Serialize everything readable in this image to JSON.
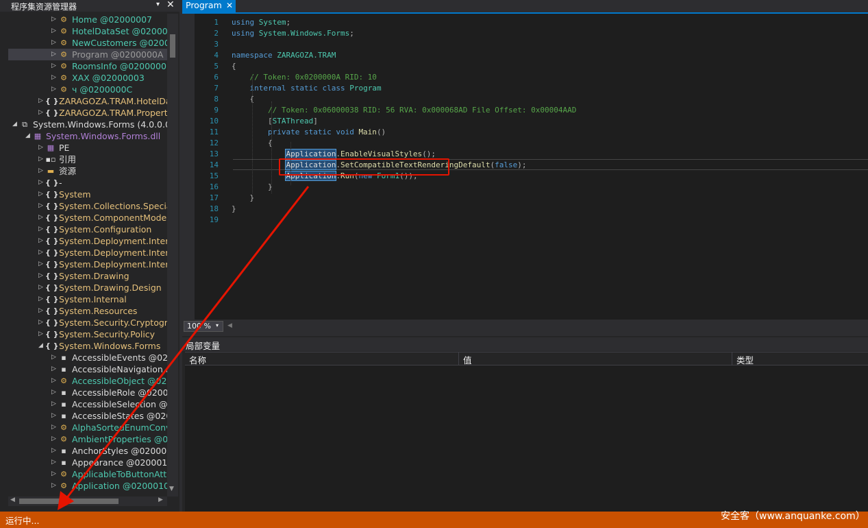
{
  "explorer": {
    "title": "程序集资源管理器",
    "dropdown_glyph": "▾",
    "close_glyph": "✕",
    "items": [
      {
        "label": "Home @02000007",
        "color": "green",
        "icon": "class-icon",
        "indent": 3,
        "expander": "▷"
      },
      {
        "label": "HotelDataSet @0200000",
        "color": "green",
        "icon": "class-icon",
        "indent": 3,
        "expander": "▷"
      },
      {
        "label": "NewCustomers @0200000",
        "color": "green",
        "icon": "class-icon",
        "indent": 3,
        "expander": "▷"
      },
      {
        "label": "Program @0200000A",
        "color": "gray",
        "icon": "class-icon",
        "indent": 3,
        "expander": "▷",
        "selected": true
      },
      {
        "label": "RoomsInfo @0200000B",
        "color": "green",
        "icon": "class-icon",
        "indent": 3,
        "expander": "▷"
      },
      {
        "label": "XAX @02000003",
        "color": "green",
        "icon": "class-icon",
        "indent": 3,
        "expander": "▷"
      },
      {
        "label": "ч @0200000C",
        "color": "green",
        "icon": "class-icon",
        "indent": 3,
        "expander": "▷"
      },
      {
        "label": "ZARAGOZA.TRAM.HotelDat",
        "color": "yellow",
        "icon": "namespace-icon",
        "indent": 2,
        "expander": "▷"
      },
      {
        "label": "ZARAGOZA.TRAM.Properti",
        "color": "yellow",
        "icon": "namespace-icon",
        "indent": 2,
        "expander": "▷"
      },
      {
        "label": "System.Windows.Forms (4.0.0.0)",
        "color": "white",
        "icon": "assembly-icon",
        "indent": 0,
        "expander": "◢"
      },
      {
        "label": "System.Windows.Forms.dll",
        "color": "purple",
        "icon": "module-icon",
        "indent": 1,
        "expander": "◢"
      },
      {
        "label": "PE",
        "color": "white",
        "icon": "pe-icon",
        "indent": 2,
        "expander": "▷"
      },
      {
        "label": "引用",
        "color": "white",
        "icon": "references-icon",
        "indent": 2,
        "expander": "▷"
      },
      {
        "label": "资源",
        "color": "white",
        "icon": "folder-icon",
        "indent": 2,
        "expander": "▷"
      },
      {
        "label": "-",
        "color": "white",
        "icon": "namespace-icon",
        "indent": 2,
        "expander": "▷"
      },
      {
        "label": "System",
        "color": "yellow",
        "icon": "namespace-icon",
        "indent": 2,
        "expander": "▷"
      },
      {
        "label": "System.Collections.Speciali",
        "color": "yellow",
        "icon": "namespace-icon",
        "indent": 2,
        "expander": "▷"
      },
      {
        "label": "System.ComponentModel",
        "color": "yellow",
        "icon": "namespace-icon",
        "indent": 2,
        "expander": "▷"
      },
      {
        "label": "System.Configuration",
        "color": "yellow",
        "icon": "namespace-icon",
        "indent": 2,
        "expander": "▷"
      },
      {
        "label": "System.Deployment.Interna",
        "color": "yellow",
        "icon": "namespace-icon",
        "indent": 2,
        "expander": "▷"
      },
      {
        "label": "System.Deployment.Interna",
        "color": "yellow",
        "icon": "namespace-icon",
        "indent": 2,
        "expander": "▷"
      },
      {
        "label": "System.Deployment.Interna",
        "color": "yellow",
        "icon": "namespace-icon",
        "indent": 2,
        "expander": "▷"
      },
      {
        "label": "System.Drawing",
        "color": "yellow",
        "icon": "namespace-icon",
        "indent": 2,
        "expander": "▷"
      },
      {
        "label": "System.Drawing.Design",
        "color": "yellow",
        "icon": "namespace-icon",
        "indent": 2,
        "expander": "▷"
      },
      {
        "label": "System.Internal",
        "color": "yellow",
        "icon": "namespace-icon",
        "indent": 2,
        "expander": "▷"
      },
      {
        "label": "System.Resources",
        "color": "yellow",
        "icon": "namespace-icon",
        "indent": 2,
        "expander": "▷"
      },
      {
        "label": "System.Security.Cryptograp",
        "color": "yellow",
        "icon": "namespace-icon",
        "indent": 2,
        "expander": "▷"
      },
      {
        "label": "System.Security.Policy",
        "color": "yellow",
        "icon": "namespace-icon",
        "indent": 2,
        "expander": "▷"
      },
      {
        "label": "System.Windows.Forms",
        "color": "yellow",
        "icon": "namespace-icon",
        "indent": 2,
        "expander": "◢"
      },
      {
        "label": "AccessibleEvents @0200",
        "color": "white",
        "icon": "enum-icon",
        "indent": 3,
        "expander": "▷"
      },
      {
        "label": "AccessibleNavigation @",
        "color": "white",
        "icon": "enum-icon",
        "indent": 3,
        "expander": "▷"
      },
      {
        "label": "AccessibleObject @020",
        "color": "green",
        "icon": "class-icon",
        "indent": 3,
        "expander": "▷"
      },
      {
        "label": "AccessibleRole @02000",
        "color": "white",
        "icon": "enum-icon",
        "indent": 3,
        "expander": "▷"
      },
      {
        "label": "AccessibleSelection @0",
        "color": "white",
        "icon": "enum-icon",
        "indent": 3,
        "expander": "▷"
      },
      {
        "label": "AccessibleStates @0200",
        "color": "white",
        "icon": "enum-icon",
        "indent": 3,
        "expander": "▷"
      },
      {
        "label": "AlphaSortedEnumConve",
        "color": "green",
        "icon": "class-icon",
        "indent": 3,
        "expander": "▷"
      },
      {
        "label": "AmbientProperties @02",
        "color": "green",
        "icon": "class-icon",
        "indent": 3,
        "expander": "▷"
      },
      {
        "label": "AnchorStyles @0200010",
        "color": "white",
        "icon": "enum-icon",
        "indent": 3,
        "expander": "▷"
      },
      {
        "label": "Appearance @0200010",
        "color": "white",
        "icon": "enum-icon",
        "indent": 3,
        "expander": "▷"
      },
      {
        "label": "ApplicableToButtonAttr",
        "color": "green",
        "icon": "class-icon",
        "indent": 3,
        "expander": "▷"
      },
      {
        "label": "Application @0200010B",
        "color": "green",
        "icon": "class-icon",
        "indent": 3,
        "expander": "▷"
      }
    ]
  },
  "editor": {
    "tab_label": "Program",
    "tab_close": "✕",
    "lines": [
      {
        "n": "1",
        "segs": [
          [
            "k",
            "using "
          ],
          [
            "n",
            "System"
          ],
          [
            "p",
            ";"
          ]
        ]
      },
      {
        "n": "2",
        "segs": [
          [
            "k",
            "using "
          ],
          [
            "n",
            "System.Windows.Forms"
          ],
          [
            "p",
            ";"
          ]
        ]
      },
      {
        "n": "3",
        "segs": []
      },
      {
        "n": "4",
        "segs": [
          [
            "k",
            "namespace "
          ],
          [
            "n",
            "ZARAGOZA.TRAM"
          ]
        ]
      },
      {
        "n": "5",
        "segs": [
          [
            "p",
            "{"
          ]
        ]
      },
      {
        "n": "6",
        "segs": [
          [
            "p",
            "    "
          ],
          [
            "cm",
            "// Token: 0x0200000A RID: 10"
          ]
        ]
      },
      {
        "n": "7",
        "segs": [
          [
            "p",
            "    "
          ],
          [
            "k",
            "internal static class "
          ],
          [
            "n",
            "Program"
          ]
        ]
      },
      {
        "n": "8",
        "segs": [
          [
            "p",
            "    {"
          ]
        ]
      },
      {
        "n": "9",
        "segs": [
          [
            "p",
            "        "
          ],
          [
            "cm",
            "// Token: 0x06000038 RID: 56 RVA: 0x000068AD File Offset: 0x00004AAD"
          ]
        ]
      },
      {
        "n": "10",
        "segs": [
          [
            "p",
            "        ["
          ],
          [
            "n",
            "STAThread"
          ],
          [
            "p",
            "]"
          ]
        ]
      },
      {
        "n": "11",
        "segs": [
          [
            "p",
            "        "
          ],
          [
            "k",
            "private static void "
          ],
          [
            "m",
            "Main"
          ],
          [
            "p",
            "()"
          ]
        ]
      },
      {
        "n": "12",
        "segs": [
          [
            "p",
            "        {"
          ]
        ]
      },
      {
        "n": "13",
        "segs": [
          [
            "p",
            "            "
          ],
          [
            "hl",
            "Application"
          ],
          [
            "p",
            "."
          ],
          [
            "m",
            "EnableVisualStyles"
          ],
          [
            "p",
            "();"
          ]
        ]
      },
      {
        "n": "14",
        "segs": [
          [
            "p",
            "            "
          ],
          [
            "hl",
            "Application"
          ],
          [
            "p",
            "."
          ],
          [
            "m",
            "SetCompatibleTextRenderingDefault"
          ],
          [
            "p",
            "("
          ],
          [
            "k",
            "false"
          ],
          [
            "p",
            ");"
          ]
        ]
      },
      {
        "n": "15",
        "segs": [
          [
            "p",
            "            "
          ],
          [
            "hl",
            "Application"
          ],
          [
            "p",
            "."
          ],
          [
            "m",
            "Run"
          ],
          [
            "p",
            "("
          ],
          [
            "k",
            "new "
          ],
          [
            "n",
            "Form1"
          ],
          [
            "p",
            "());"
          ]
        ]
      },
      {
        "n": "16",
        "segs": [
          [
            "p",
            "        }"
          ]
        ]
      },
      {
        "n": "17",
        "segs": [
          [
            "p",
            "    }"
          ]
        ]
      },
      {
        "n": "18",
        "segs": [
          [
            "p",
            "}"
          ]
        ]
      },
      {
        "n": "19",
        "segs": []
      }
    ],
    "zoom": "100 %",
    "zoom_arrow": "▾"
  },
  "locals": {
    "title": "局部变量",
    "columns": [
      "名称",
      "值",
      "类型"
    ]
  },
  "statusbar": {
    "status": "运行中...",
    "watermark": "安全客（www.anquanke.com）"
  },
  "colors": {
    "accent": "#007acc",
    "status_bar": "#ca5100",
    "annotation_red": "#e51400"
  }
}
